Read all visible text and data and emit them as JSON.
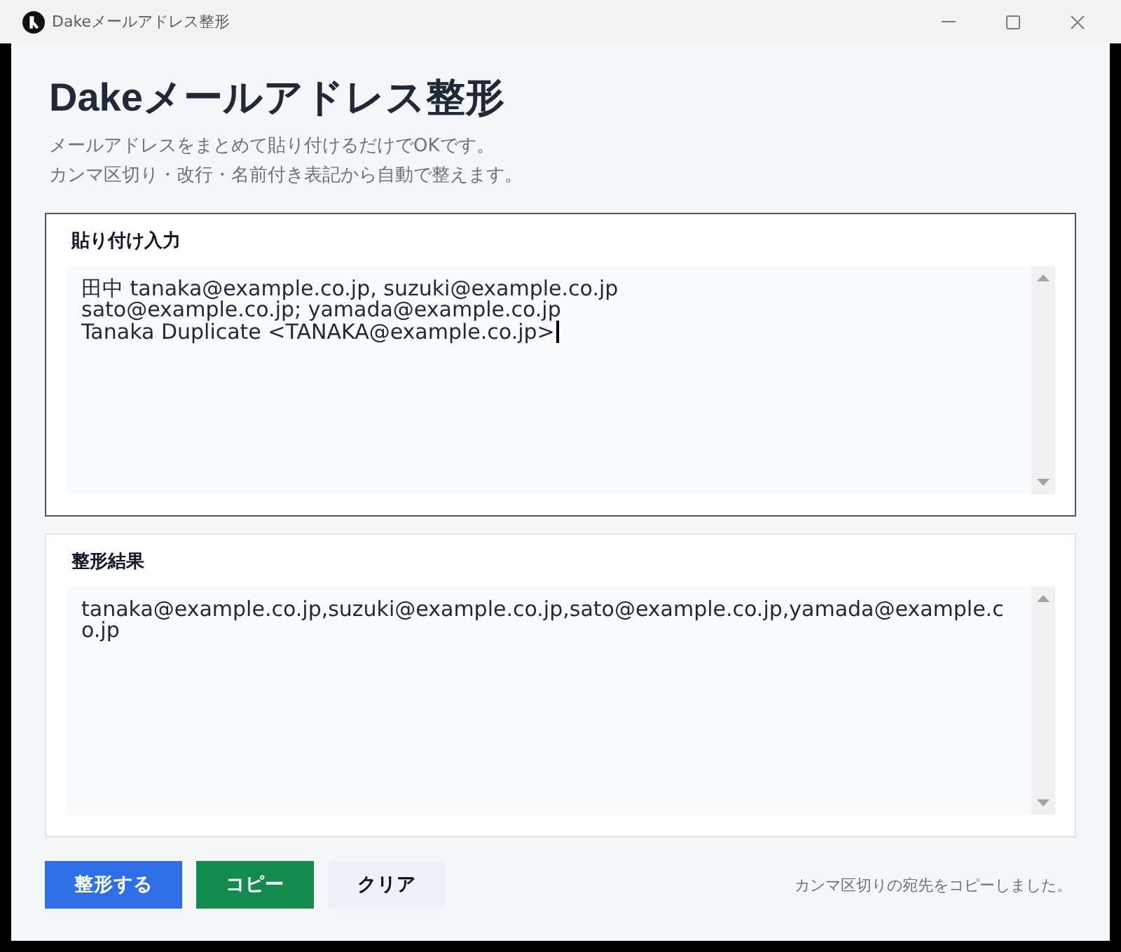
{
  "window": {
    "title": "Dakeメールアドレス整形"
  },
  "header": {
    "title": "Dakeメールアドレス整形",
    "description": [
      "メールアドレスをまとめて貼り付けるだけでOKです。",
      "カンマ区切り・改行・名前付き表記から自動で整えます。"
    ]
  },
  "panels": [
    {
      "label": "貼り付け入力",
      "value": "田中 tanaka@example.co.jp, suzuki@example.co.jp\nsato@example.co.jp; yamada@example.co.jp\nTanaka Duplicate <TANAKA@example.co.jp>",
      "focused": true
    },
    {
      "label": "整形結果",
      "value": "tanaka@example.co.jp,suzuki@example.co.jp,sato@example.co.jp,yamada@example.co.jp",
      "focused": false
    }
  ],
  "buttons": [
    {
      "label": "整形する",
      "kind": "primary"
    },
    {
      "label": "コピー",
      "kind": "success"
    },
    {
      "label": "クリア",
      "kind": "secondary"
    }
  ],
  "status_message": "カンマ区切りの宛先をコピーしました。"
}
